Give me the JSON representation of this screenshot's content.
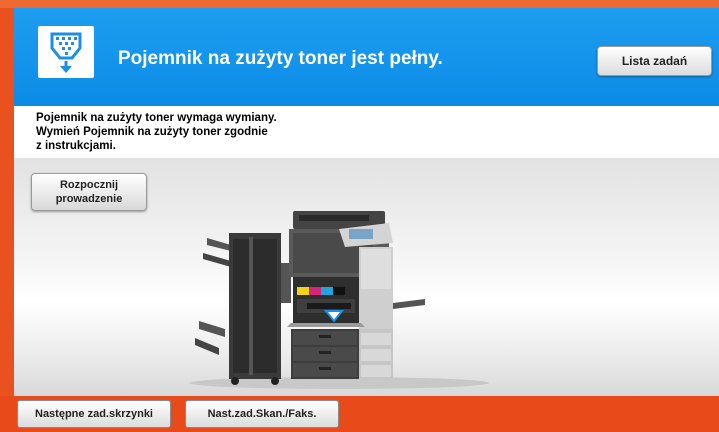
{
  "header": {
    "title": "Pojemnik na zużyty toner jest pełny.",
    "status_icon": "waste-toner-icon",
    "job_list_label": "Lista zadań"
  },
  "message": {
    "lines": [
      "Pojemnik na zużyty toner wymaga wymiany.",
      "Wymień Pojemnik na zużyty toner zgodnie",
      "z instrukcjami."
    ]
  },
  "guide": {
    "label_line1": "Rozpocznij",
    "label_line2": "prowadzenie"
  },
  "footer": {
    "next_box_job_label": "Następne zad.skrzynki",
    "next_scan_fax_label": "Nast.zad.Skan./Faks."
  },
  "colors": {
    "accent_blue": "#0b8be6",
    "frame_orange": "#e84a1a"
  }
}
